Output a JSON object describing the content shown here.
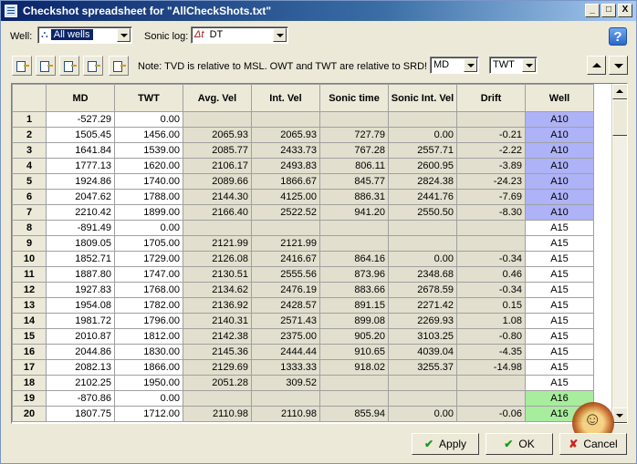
{
  "window": {
    "title": "Checkshot spreadsheet for \"AllCheckShots.txt\"",
    "buttons": [
      "_",
      "□",
      "X"
    ]
  },
  "toolbar1": {
    "well_label": "Well:",
    "well_value": "All wells",
    "sonic_label": "Sonic log:",
    "sonic_prefix": "Δt",
    "sonic_value": "DT",
    "help": "?"
  },
  "toolbar2": {
    "note": "Note: TVD is relative to MSL. OWT and TWT are relative to SRD!",
    "depth_select": "MD",
    "time_select": "TWT",
    "tool_icons": [
      "insert-row-icon",
      "insert-above-icon",
      "insert-below-icon",
      "move-row-icon",
      "paste-icon"
    ]
  },
  "table": {
    "headers": [
      "MD",
      "TWT",
      "Avg. Vel",
      "Int. Vel",
      "Sonic time",
      "Sonic Int. Vel",
      "Drift",
      "Well"
    ],
    "rows": [
      {
        "n": "1",
        "md": "-527.29",
        "twt": "0.00",
        "avg": "",
        "int": "",
        "st": "",
        "siv": "",
        "drift": "",
        "well": "A10"
      },
      {
        "n": "2",
        "md": "1505.45",
        "twt": "1456.00",
        "avg": "2065.93",
        "int": "2065.93",
        "st": "727.79",
        "siv": "0.00",
        "drift": "-0.21",
        "well": "A10"
      },
      {
        "n": "3",
        "md": "1641.84",
        "twt": "1539.00",
        "avg": "2085.77",
        "int": "2433.73",
        "st": "767.28",
        "siv": "2557.71",
        "drift": "-2.22",
        "well": "A10"
      },
      {
        "n": "4",
        "md": "1777.13",
        "twt": "1620.00",
        "avg": "2106.17",
        "int": "2493.83",
        "st": "806.11",
        "siv": "2600.95",
        "drift": "-3.89",
        "well": "A10"
      },
      {
        "n": "5",
        "md": "1924.86",
        "twt": "1740.00",
        "avg": "2089.66",
        "int": "1866.67",
        "st": "845.77",
        "siv": "2824.38",
        "drift": "-24.23",
        "well": "A10"
      },
      {
        "n": "6",
        "md": "2047.62",
        "twt": "1788.00",
        "avg": "2144.30",
        "int": "4125.00",
        "st": "886.31",
        "siv": "2441.76",
        "drift": "-7.69",
        "well": "A10"
      },
      {
        "n": "7",
        "md": "2210.42",
        "twt": "1899.00",
        "avg": "2166.40",
        "int": "2522.52",
        "st": "941.20",
        "siv": "2550.50",
        "drift": "-8.30",
        "well": "A10"
      },
      {
        "n": "8",
        "md": "-891.49",
        "twt": "0.00",
        "avg": "",
        "int": "",
        "st": "",
        "siv": "",
        "drift": "",
        "well": "A15"
      },
      {
        "n": "9",
        "md": "1809.05",
        "twt": "1705.00",
        "avg": "2121.99",
        "int": "2121.99",
        "st": "",
        "siv": "",
        "drift": "",
        "well": "A15"
      },
      {
        "n": "10",
        "md": "1852.71",
        "twt": "1729.00",
        "avg": "2126.08",
        "int": "2416.67",
        "st": "864.16",
        "siv": "0.00",
        "drift": "-0.34",
        "well": "A15"
      },
      {
        "n": "11",
        "md": "1887.80",
        "twt": "1747.00",
        "avg": "2130.51",
        "int": "2555.56",
        "st": "873.96",
        "siv": "2348.68",
        "drift": "0.46",
        "well": "A15"
      },
      {
        "n": "12",
        "md": "1927.83",
        "twt": "1768.00",
        "avg": "2134.62",
        "int": "2476.19",
        "st": "883.66",
        "siv": "2678.59",
        "drift": "-0.34",
        "well": "A15"
      },
      {
        "n": "13",
        "md": "1954.08",
        "twt": "1782.00",
        "avg": "2136.92",
        "int": "2428.57",
        "st": "891.15",
        "siv": "2271.42",
        "drift": "0.15",
        "well": "A15"
      },
      {
        "n": "14",
        "md": "1981.72",
        "twt": "1796.00",
        "avg": "2140.31",
        "int": "2571.43",
        "st": "899.08",
        "siv": "2269.93",
        "drift": "1.08",
        "well": "A15"
      },
      {
        "n": "15",
        "md": "2010.87",
        "twt": "1812.00",
        "avg": "2142.38",
        "int": "2375.00",
        "st": "905.20",
        "siv": "3103.25",
        "drift": "-0.80",
        "well": "A15"
      },
      {
        "n": "16",
        "md": "2044.86",
        "twt": "1830.00",
        "avg": "2145.36",
        "int": "2444.44",
        "st": "910.65",
        "siv": "4039.04",
        "drift": "-4.35",
        "well": "A15"
      },
      {
        "n": "17",
        "md": "2082.13",
        "twt": "1866.00",
        "avg": "2129.69",
        "int": "1333.33",
        "st": "918.02",
        "siv": "3255.37",
        "drift": "-14.98",
        "well": "A15"
      },
      {
        "n": "18",
        "md": "2102.25",
        "twt": "1950.00",
        "avg": "2051.28",
        "int": "309.52",
        "st": "",
        "siv": "",
        "drift": "",
        "well": "A15"
      },
      {
        "n": "19",
        "md": "-870.86",
        "twt": "0.00",
        "avg": "",
        "int": "",
        "st": "",
        "siv": "",
        "drift": "",
        "well": "A16"
      },
      {
        "n": "20",
        "md": "1807.75",
        "twt": "1712.00",
        "avg": "2110.98",
        "int": "2110.98",
        "st": "855.94",
        "siv": "0.00",
        "drift": "-0.06",
        "well": "A16"
      }
    ]
  },
  "buttons": {
    "apply": "Apply",
    "ok": "OK",
    "cancel": "Cancel"
  },
  "colors": {
    "A10": "#aeb2f7",
    "A15": "#ffffff",
    "A16": "#a8ec9e"
  }
}
